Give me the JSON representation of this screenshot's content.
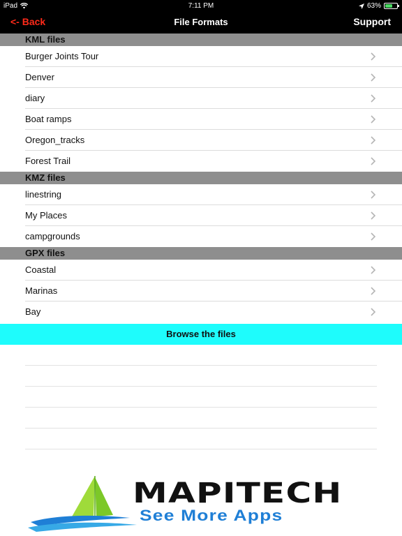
{
  "status_bar": {
    "device": "iPad",
    "time": "7:11 PM",
    "battery_percent_label": "63%",
    "battery_level": 0.63,
    "icons": [
      "wifi-icon",
      "location-icon",
      "battery-icon"
    ]
  },
  "nav": {
    "back_label": "<- Back",
    "title": "File Formats",
    "support_label": "Support",
    "back_color": "#ff2a1a"
  },
  "sections": [
    {
      "header": "KML files",
      "items": [
        "Burger Joints Tour",
        "Denver",
        "diary",
        "Boat ramps",
        "Oregon_tracks",
        "Forest Trail"
      ]
    },
    {
      "header": "KMZ files",
      "items": [
        "linestring",
        "My Places",
        "campgrounds"
      ]
    },
    {
      "header": "GPX files",
      "items": [
        "Coastal",
        "Marinas",
        "Bay"
      ]
    }
  ],
  "browse": {
    "label": "Browse the files",
    "color": "#1efcfc"
  },
  "banner": {
    "brand": "MAPITECH",
    "tagline": "See More Apps",
    "brand_color": "#111111",
    "tagline_color": "#1f7fd6"
  }
}
